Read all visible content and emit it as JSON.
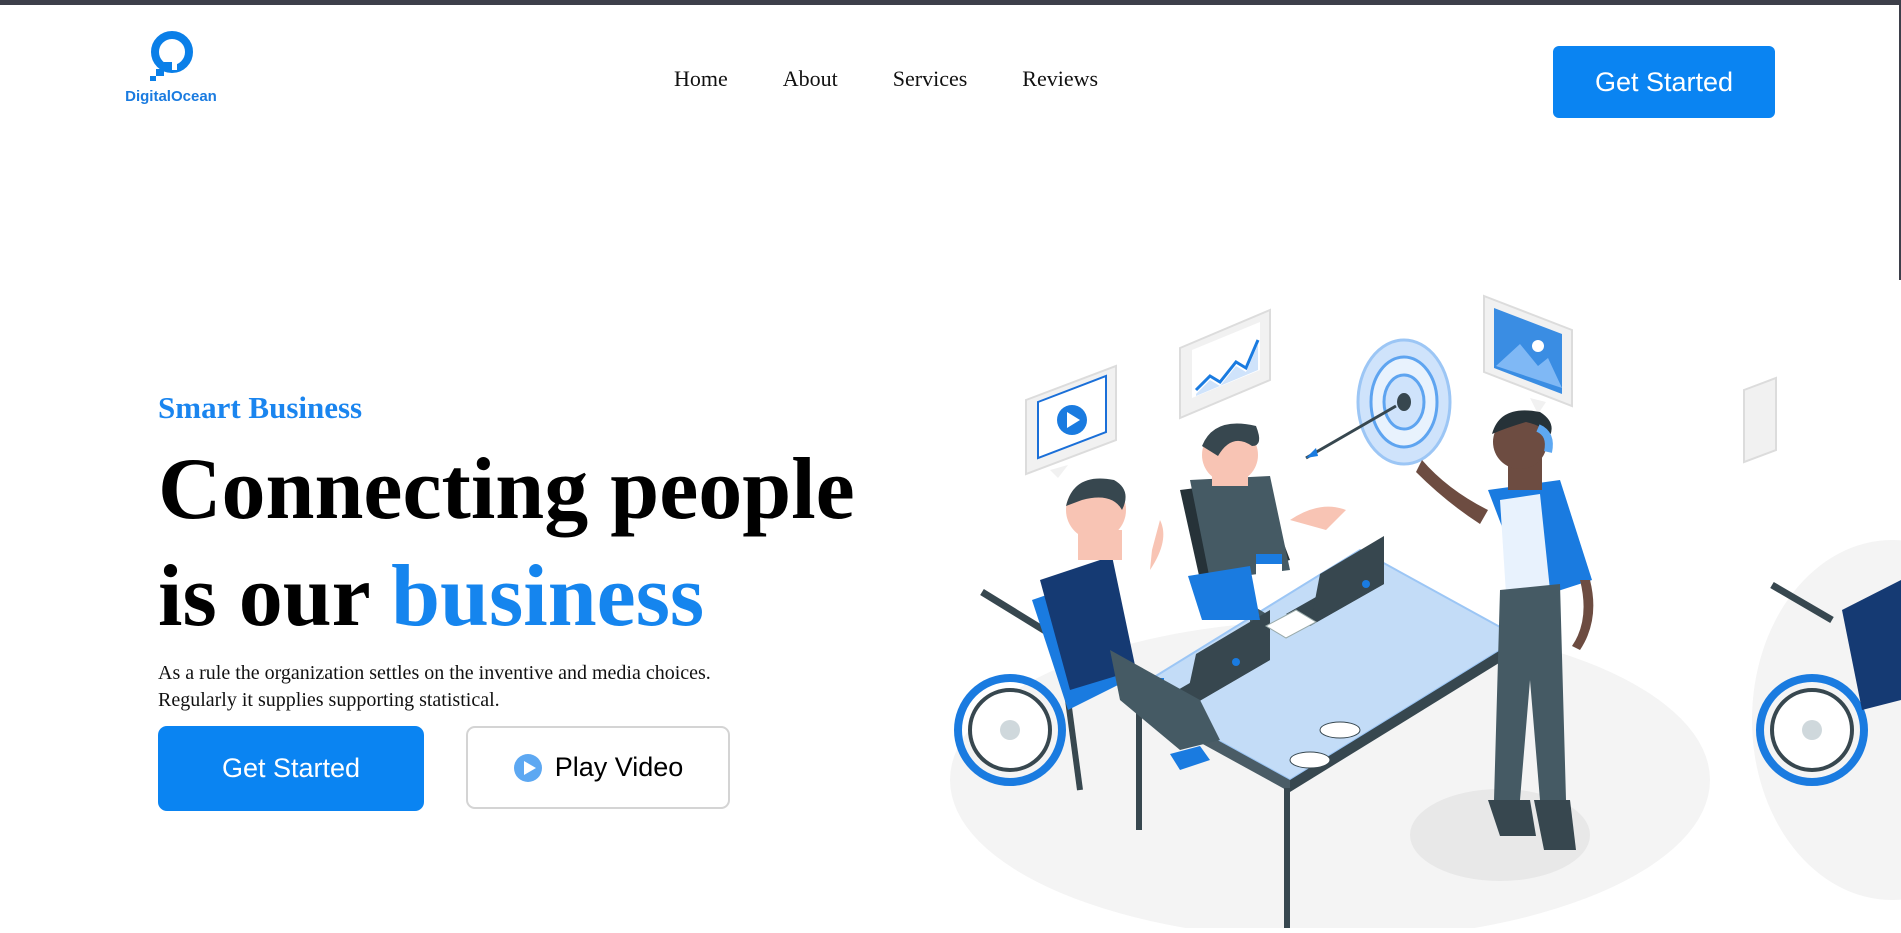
{
  "brand": {
    "name": "DigitalOcean"
  },
  "nav": {
    "items": [
      "Home",
      "About",
      "Services",
      "Reviews"
    ]
  },
  "header": {
    "cta_label": "Get Started"
  },
  "hero": {
    "eyebrow": "Smart Business",
    "headline_line1": "Connecting people",
    "headline_line2_prefix": "is our ",
    "headline_accent": "business",
    "description": "As a rule the organization settles on the inventive and media choices. Regularly it supplies supporting statistical.",
    "primary_cta": "Get Started",
    "video_cta": "Play Video"
  },
  "colors": {
    "accent": "#0a84f2",
    "accent_text": "#1585ee",
    "frame": "#3d3f4a"
  },
  "icons": {
    "logo": "digitalocean-logo",
    "play": "play-icon"
  }
}
